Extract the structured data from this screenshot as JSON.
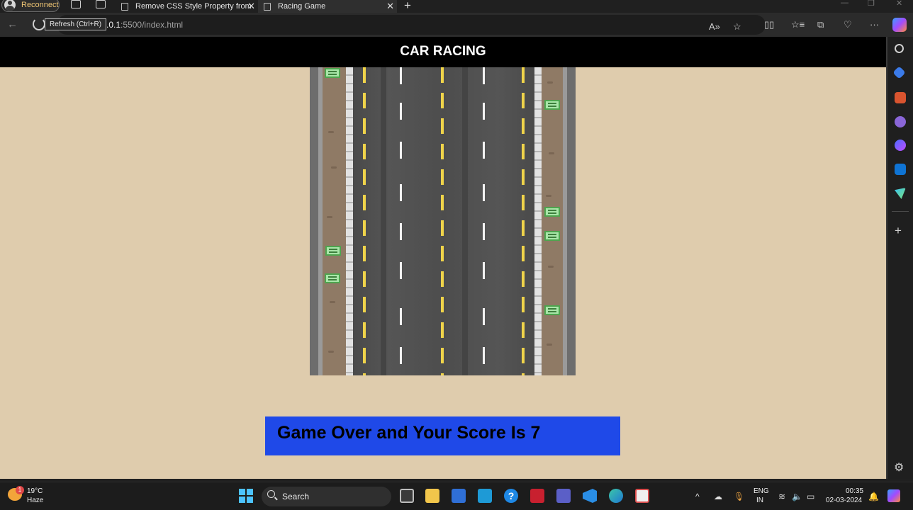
{
  "browser": {
    "profile_label": "Reconnect",
    "tabs": [
      {
        "title": "Remove CSS Style Property from",
        "active": false
      },
      {
        "title": "Racing Game",
        "active": true
      }
    ],
    "new_tab_label": "+",
    "url_host": "127.0.0.1",
    "url_full": "127.0.0.1:5500/index.html",
    "tooltip": "Refresh (Ctrl+R)"
  },
  "page": {
    "title": "CAR RACING",
    "game_over_text": "Game Over and Your Score Is 7",
    "colors": {
      "background": "#dfccad",
      "header": "#000000",
      "banner": "#1f49e8",
      "lane_yellow": "#f0d44a"
    }
  },
  "sidebar": {
    "icons": [
      "search-icon",
      "tag-icon",
      "toolbox-icon",
      "people-icon",
      "copilot-icon",
      "outlook-icon",
      "send-icon",
      "add-icon",
      "settings-icon"
    ]
  },
  "taskbar": {
    "weather_temp": "19°C",
    "weather_condition": "Haze",
    "weather_badge": "1",
    "search_label": "Search",
    "language_line1": "ENG",
    "language_line2": "IN",
    "time": "00:35",
    "date": "02-03-2024"
  }
}
